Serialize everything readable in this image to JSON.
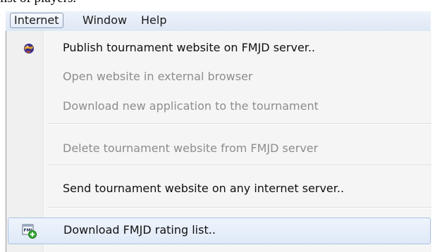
{
  "background_text": "list of players.",
  "menubar": {
    "items": [
      {
        "label": "Internet"
      },
      {
        "label": "Window"
      },
      {
        "label": "Help"
      }
    ]
  },
  "menu": {
    "items": [
      {
        "label": "Publish tournament website on FMJD server..",
        "enabled": true,
        "icon": "globe-icon"
      },
      {
        "label": "Open website in external browser",
        "enabled": false
      },
      {
        "label": "Download new application to the tournament",
        "enabled": false
      },
      {
        "label": "Delete tournament website from FMJD server",
        "enabled": false
      },
      {
        "label": "Send tournament website on any internet server..",
        "enabled": true
      },
      {
        "label": "Download FMJD rating list..",
        "enabled": true,
        "icon": "fmjd-download-icon",
        "highlighted": true
      }
    ]
  },
  "colors": {
    "enabled_text": "#111111",
    "disabled_text": "#8d8d8d",
    "highlight_border": "#a8c2e6"
  }
}
